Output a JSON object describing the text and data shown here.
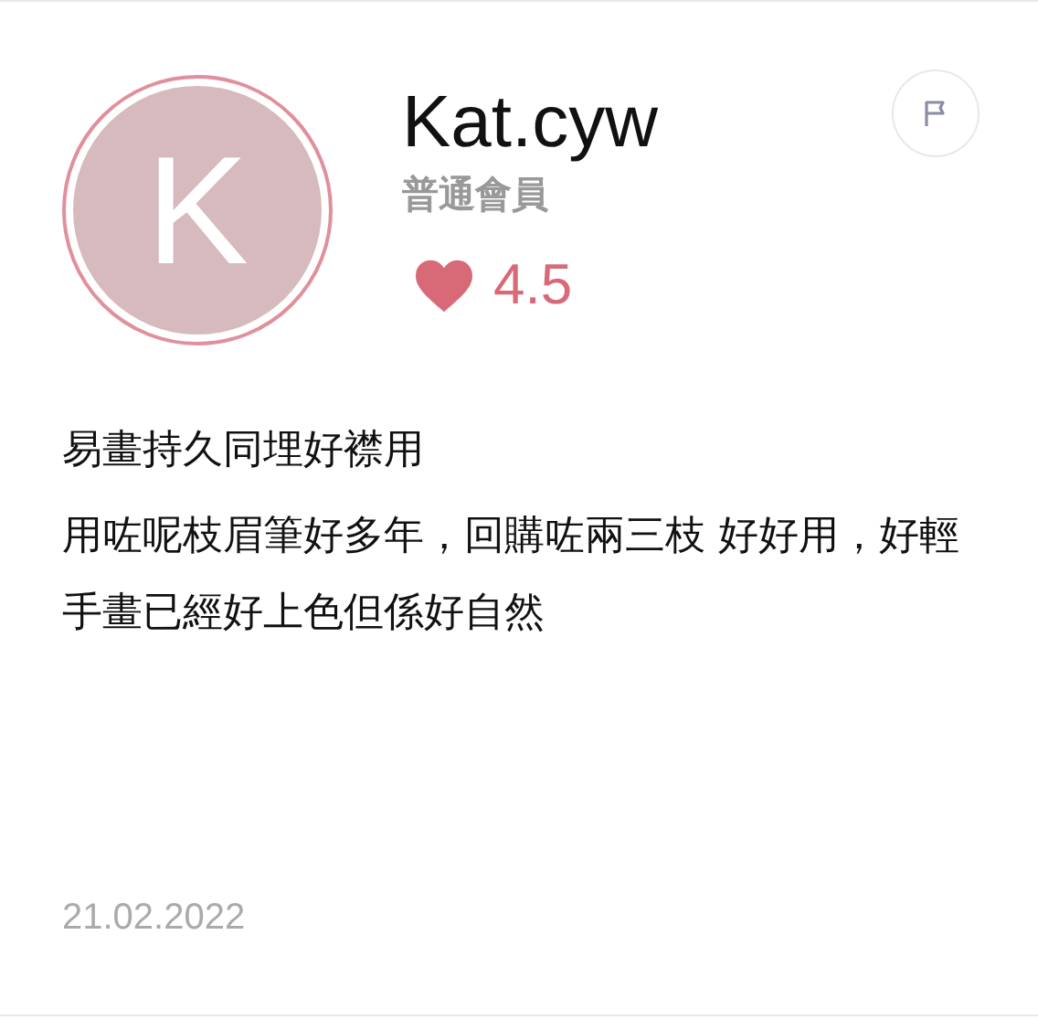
{
  "reviewer": {
    "avatar_letter": "K",
    "name": "Kat.cyw",
    "membership": "普通會員",
    "rating": "4.5"
  },
  "review": {
    "title": "易畫持久同埋好襟用",
    "body": "用咗呢枝眉筆好多年，回購咗兩三枝 好好用，好輕手畫已經好上色但係好自然",
    "date": "21.02.2022"
  }
}
